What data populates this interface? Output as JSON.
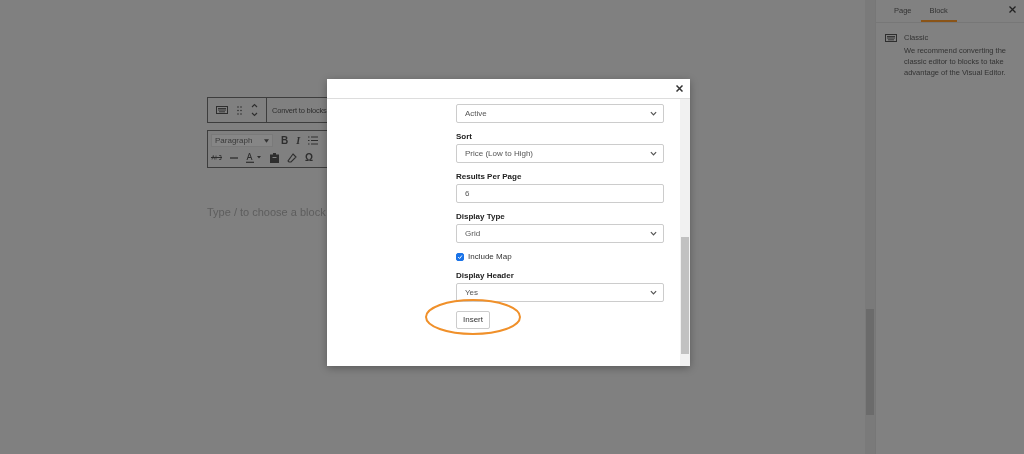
{
  "editor": {
    "block_toolbar": {
      "label": "Convert to blocks"
    },
    "format_toolbar": {
      "style": "Paragraph",
      "bold": "B",
      "italic": "I",
      "special_char": "Ω"
    },
    "placeholder": "Type / to choose a block"
  },
  "sidebar": {
    "tabs": [
      {
        "label": "Page",
        "selected": false
      },
      {
        "label": "Block",
        "selected": true
      }
    ],
    "block": {
      "title": "Classic",
      "description": "We recommend converting the classic editor to blocks to take advantage of the Visual Editor."
    }
  },
  "modal": {
    "fields": [
      {
        "kind": "select",
        "value": "Active"
      },
      {
        "kind": "select",
        "label": "Sort",
        "value": "Price (Low to High)"
      },
      {
        "kind": "input",
        "label": "Results Per Page",
        "value": "6"
      },
      {
        "kind": "select",
        "label": "Display Type",
        "value": "Grid"
      },
      {
        "kind": "checkbox",
        "label": "Include Map",
        "checked": true
      },
      {
        "kind": "select",
        "label": "Display Header",
        "value": "Yes"
      }
    ],
    "submit": "Insert",
    "highlight": true
  }
}
